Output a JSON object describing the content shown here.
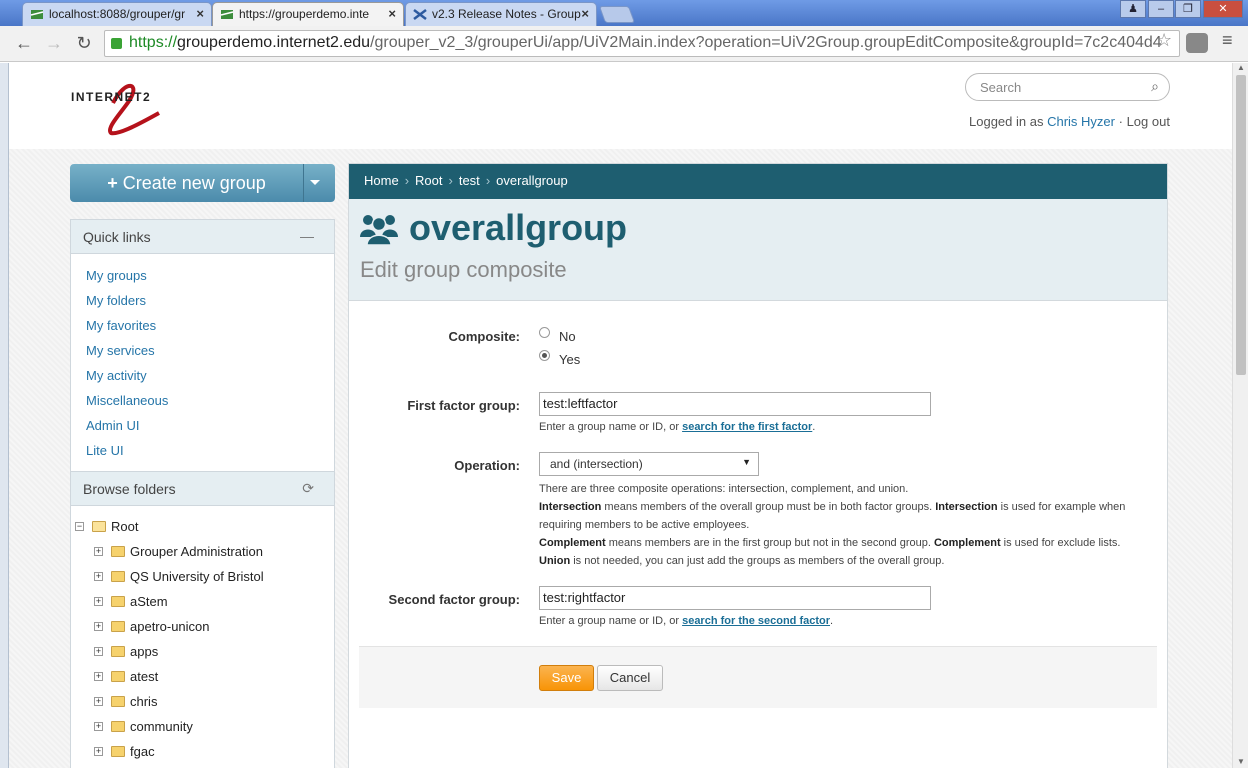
{
  "browser": {
    "tabs": [
      {
        "title": "localhost:8088/grouper/gr"
      },
      {
        "title": "https://grouperdemo.inte"
      },
      {
        "title": "v2.3 Release Notes - Group"
      }
    ],
    "url_scheme": "https://",
    "url_host": "grouperdemo.internet2.edu",
    "url_path": "/grouper_v2_3/grouperUi/app/UiV2Main.index?operation=UiV2Group.groupEditComposite&groupId=7c2c404d4",
    "window_buttons": [
      "minimize",
      "maximize",
      "close"
    ]
  },
  "header": {
    "logo_text": "INTERNET2",
    "search_placeholder": "Search",
    "logged_in_prefix": "Logged in as",
    "user_name": "Chris Hyzer",
    "separator": "·",
    "logout": "Log out"
  },
  "sidebar": {
    "create_button": "Create new group",
    "quick_links_title": "Quick links",
    "quick_links": [
      "My groups",
      "My folders",
      "My favorites",
      "My services",
      "My activity",
      "Miscellaneous",
      "Admin UI",
      "Lite UI"
    ],
    "browse_title": "Browse folders",
    "tree_root": "Root",
    "tree_items": [
      "Grouper Administration",
      "QS University of Bristol",
      "aStem",
      "apetro-unicon",
      "apps",
      "atest",
      "chris",
      "community",
      "fgac"
    ]
  },
  "breadcrumb": [
    "Home",
    "Root",
    "test",
    "overallgroup"
  ],
  "page": {
    "title": "overallgroup",
    "subtitle": "Edit group composite"
  },
  "form": {
    "composite_label": "Composite:",
    "composite_options": [
      "No",
      "Yes"
    ],
    "composite_selected": "Yes",
    "first_factor_label": "First factor group:",
    "first_factor_value": "test:leftfactor",
    "first_help_prefix": "Enter a group name or ID, or",
    "first_help_link": "search for the first factor",
    "first_help_suffix": ".",
    "operation_label": "Operation:",
    "operation_value": "and (intersection)",
    "op_help_intro": "There are three composite operations: intersection, complement, and union.",
    "op_help_intersection_term": "Intersection",
    "op_help_intersection_text1": "means members of the overall group must be in both factor groups.",
    "op_help_intersection_term2": "Intersection",
    "op_help_intersection_text2": "is used for example when",
    "op_help_intersection_text3": "requiring members to be active employees.",
    "op_help_complement_term": "Complement",
    "op_help_complement_text1": "means members are in the first group but not in the second group.",
    "op_help_complement_term2": "Complement",
    "op_help_complement_text2": "is used for exclude lists.",
    "op_help_union_term": "Union",
    "op_help_union_text": "is not needed, you can just add the groups as members of the overall group.",
    "second_factor_label": "Second factor group:",
    "second_factor_value": "test:rightfactor",
    "second_help_prefix": "Enter a group name or ID, or",
    "second_help_link": "search for the second factor",
    "second_help_suffix": ".",
    "save": "Save",
    "cancel": "Cancel"
  },
  "colors": {
    "accent": "#1e5e70",
    "link": "#2575a8",
    "save": "#f89406",
    "create_button": "#5d9bb6"
  }
}
